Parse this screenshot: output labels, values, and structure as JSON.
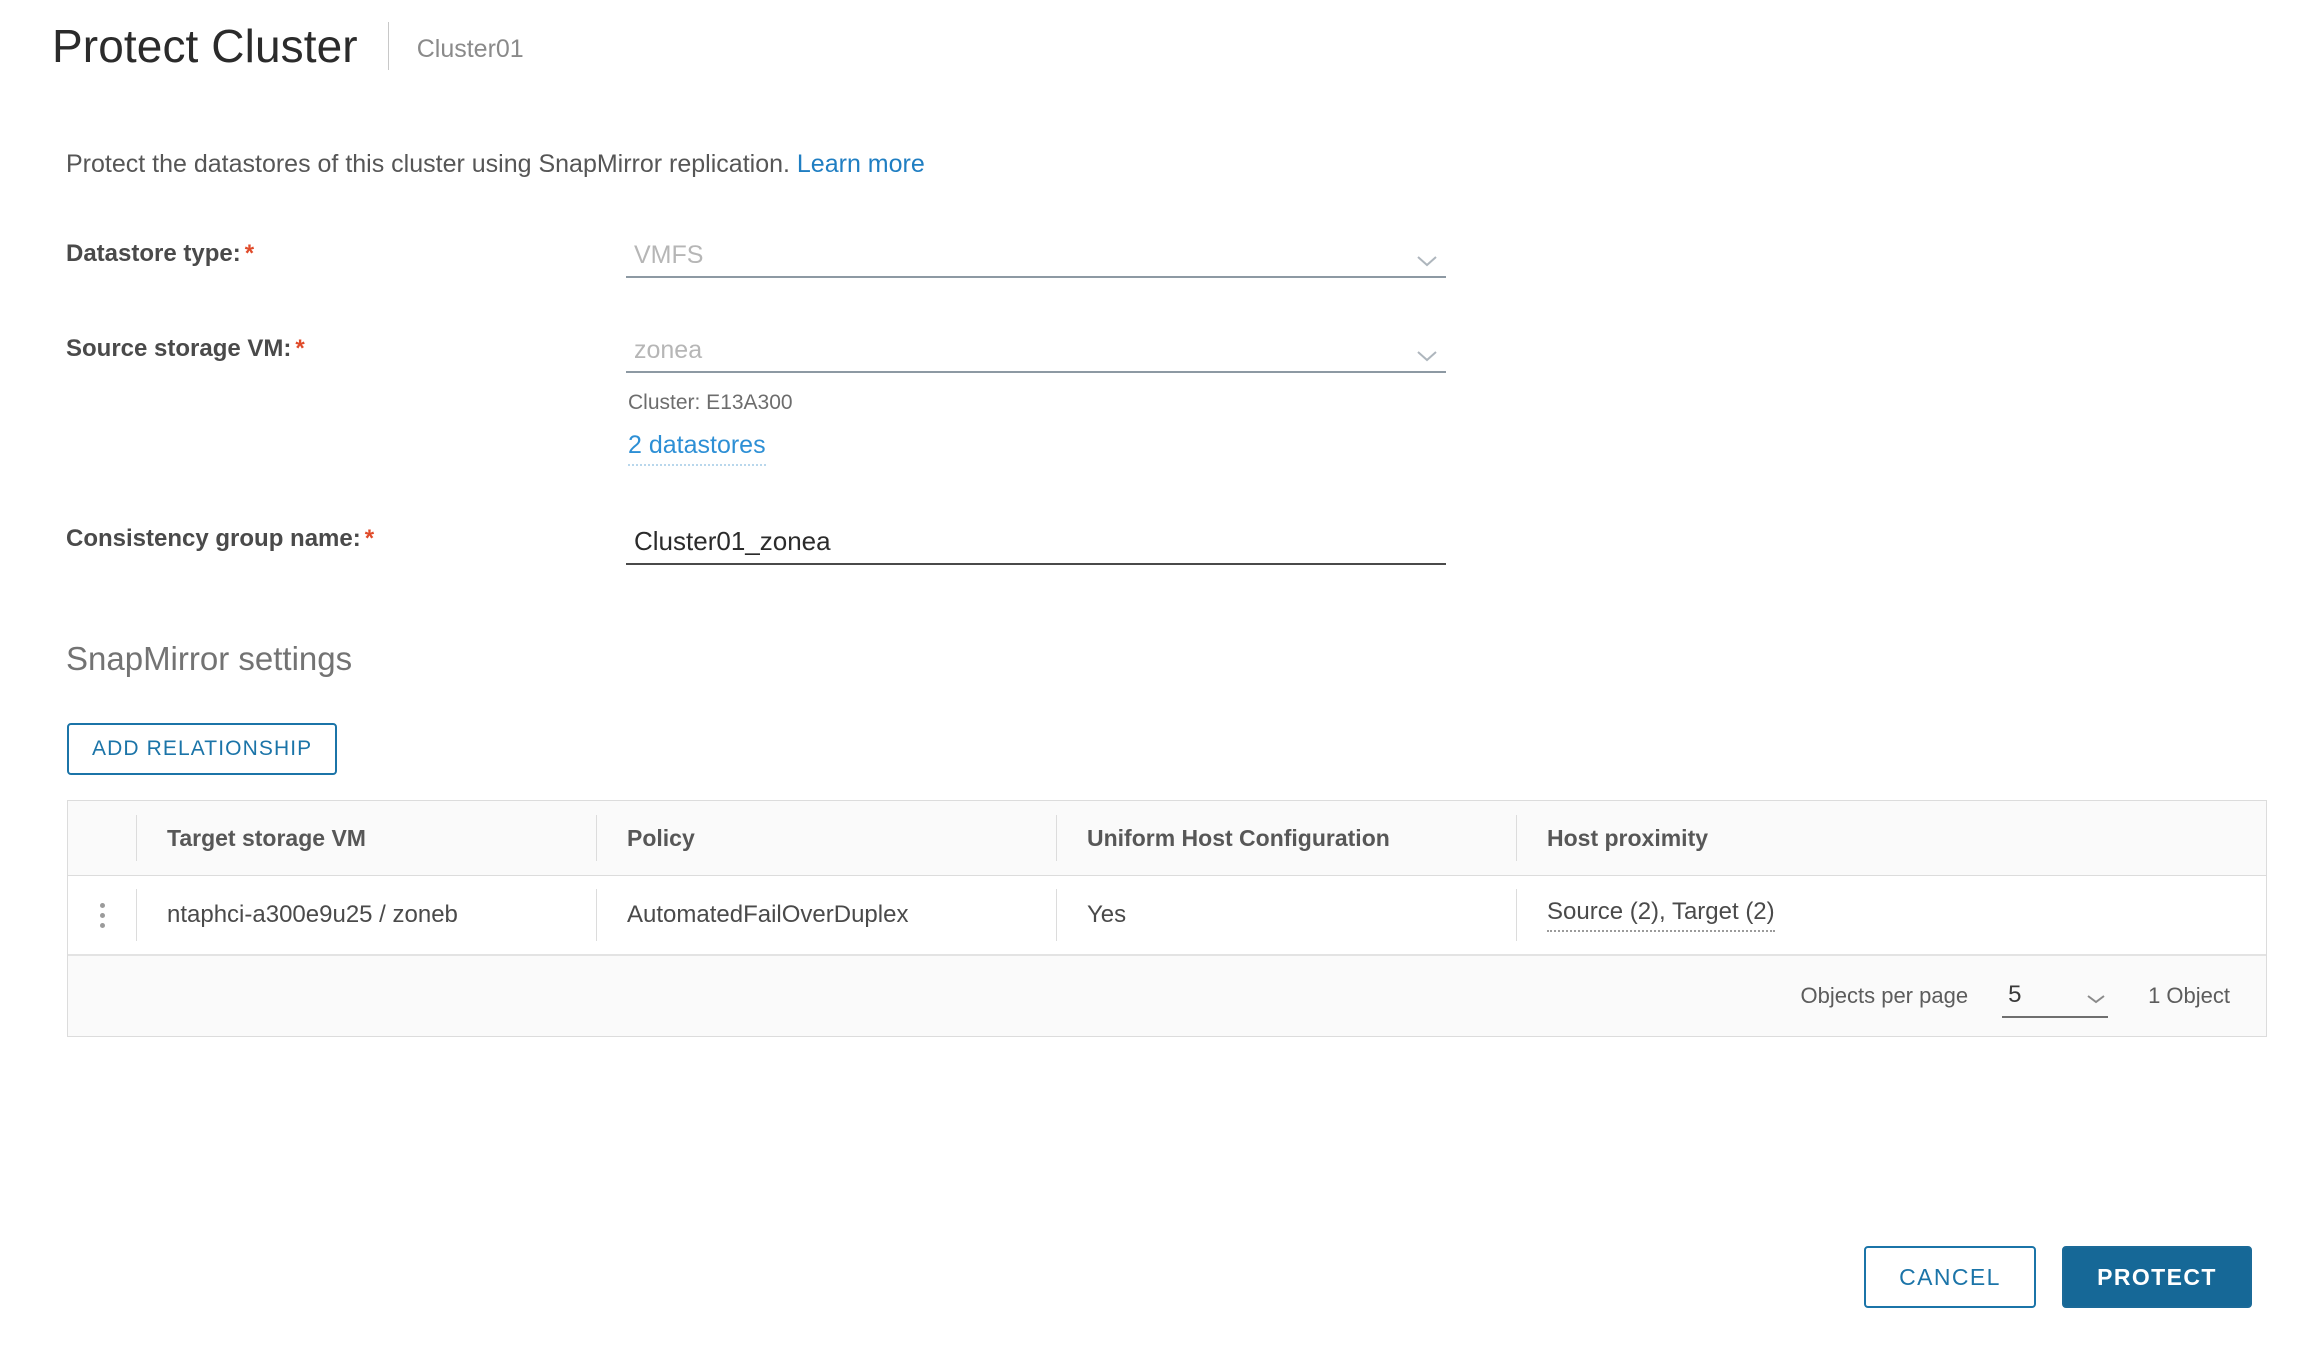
{
  "header": {
    "title": "Protect Cluster",
    "subtitle": "Cluster01"
  },
  "intro": {
    "text": "Protect the datastores of this cluster using SnapMirror replication.",
    "link_label": "Learn more"
  },
  "form": {
    "datastore_type": {
      "label": "Datastore type:",
      "required_mark": "*",
      "value": "VMFS",
      "icon": "chevron-down-icon"
    },
    "source_storage_vm": {
      "label": "Source storage VM:",
      "required_mark": "*",
      "value": "zonea",
      "icon": "chevron-down-icon",
      "cluster_note": "Cluster: E13A300",
      "datastores_link": "2 datastores"
    },
    "consistency_group_name": {
      "label": "Consistency group name:",
      "required_mark": "*",
      "value": "Cluster01_zonea"
    }
  },
  "snapmirror": {
    "section_title": "SnapMirror settings",
    "add_relationship_label": "ADD RELATIONSHIP",
    "table": {
      "columns": [
        "Target storage VM",
        "Policy",
        "Uniform Host Configuration",
        "Host proximity"
      ],
      "rows": [
        {
          "menu_icon": "kebab-menu-icon",
          "target_storage_vm": "ntaphci-a300e9u25 / zoneb",
          "policy": "AutomatedFailOverDuplex",
          "uniform_host_configuration": "Yes",
          "host_proximity": "Source (2), Target (2)"
        }
      ],
      "footer": {
        "objects_per_page_label": "Objects per page",
        "objects_per_page_value": "5",
        "objects_per_page_icon": "chevron-down-icon",
        "object_count": "1 Object"
      }
    }
  },
  "footer": {
    "cancel_label": "CANCEL",
    "protect_label": "PROTECT"
  },
  "colors": {
    "accent_blue": "#1b74a8",
    "primary_button": "#166897",
    "link_blue": "#2d8fd5",
    "required_red": "#e04b2a"
  }
}
